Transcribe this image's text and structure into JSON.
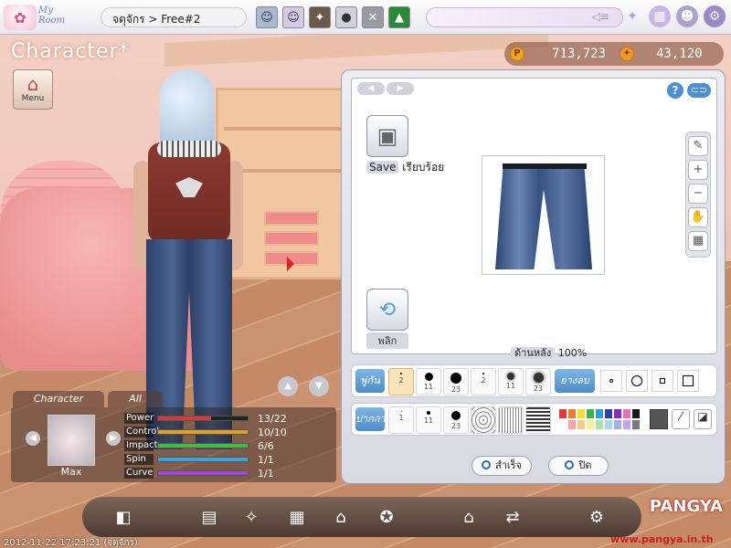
{
  "topbar": {
    "myroom": "My Room",
    "server_path": "จตุจักร > Free#2"
  },
  "scene": {
    "title": "Character",
    "menu_label": "Menu"
  },
  "currency": {
    "pang": "713,723",
    "cookie": "43,120"
  },
  "panel": {
    "save_label": "Save",
    "save_status": "เรียบร้อย",
    "turn_label": "พลิก",
    "background_label": "ด้านหลัง",
    "background_percent": "100%",
    "brush_tag": "พู่กัน",
    "eraser_tag": "ยางลบ",
    "pattern_tag": "ปากกา",
    "brush_sizes_row1": [
      "2",
      "11",
      "23",
      "2",
      "11",
      "23"
    ],
    "brush_sizes_row2": [
      "1",
      "11",
      "23"
    ],
    "done_label": "สำเร็จ",
    "close_label": "ปิด",
    "palette_colors": [
      "#e03a3a",
      "#f07b2a",
      "#f0e02a",
      "#39b54a",
      "#2a9fd8",
      "#2a3fa8",
      "#8a2ab8",
      "#ee6fb0",
      "#1c1c1c",
      "#ffffff",
      "#f7a6a6",
      "#f8c98e",
      "#f7f19a",
      "#a8e0a8",
      "#a9d7f2",
      "#a4aee8",
      "#c7a6e6",
      "#7a7a7a"
    ]
  },
  "character": {
    "tab_character": "Character",
    "tab_all": "All",
    "name": "Max",
    "stats": [
      {
        "label": "Power",
        "value": "13/22",
        "fraction": 0.59,
        "color": "#d23b3b"
      },
      {
        "label": "Control",
        "value": "10/10",
        "fraction": 1.0,
        "color": "#e0a020"
      },
      {
        "label": "Impact",
        "value": "6/6",
        "fraction": 1.0,
        "color": "#3fbf3f"
      },
      {
        "label": "Spin",
        "value": "1/1",
        "fraction": 1.0,
        "color": "#3aa3e0"
      },
      {
        "label": "Curve",
        "value": "1/1",
        "fraction": 1.0,
        "color": "#a04ad0"
      }
    ]
  },
  "footer": {
    "timestamp": "2012-11-22 17:23:21 (จตุจักร)",
    "logo": "PANGYA",
    "site": "www.pangya.in.th"
  }
}
